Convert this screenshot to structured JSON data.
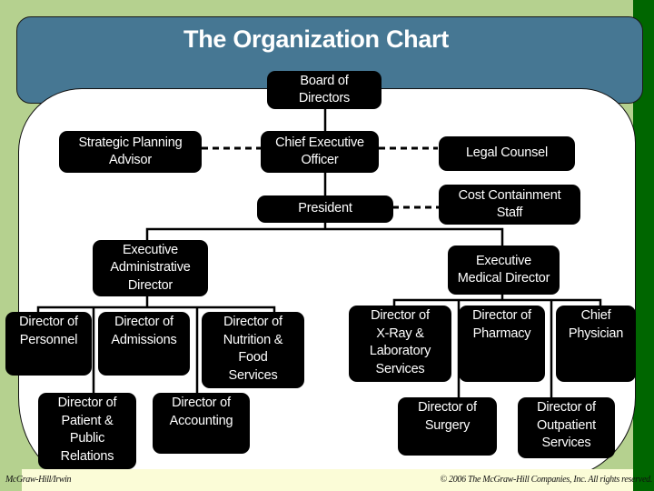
{
  "title": "The Organization Chart",
  "footer": {
    "left": "McGraw-Hill/Irwin",
    "right": "© 2006 The McGraw-Hill Companies, Inc. All rights reserved."
  },
  "colors": {
    "background": "#b5d18f",
    "title_panel": "#467793",
    "accent_bar": "#006600",
    "node_fill": "#000000",
    "node_text": "#ffffff",
    "footer_strip": "#fbfcd7"
  },
  "nodes": {
    "board": "Board of\nDirectors",
    "strategic": "Strategic Planning\nAdvisor",
    "ceo": "Chief Executive\nOfficer",
    "legal": "Legal Counsel",
    "president": "President",
    "cost": "Cost Containment\nStaff",
    "exec_admin": "Executive\nAdministrative\nDirector",
    "exec_med": "Executive\nMedical Director",
    "personnel": "Director of\nPersonnel",
    "admissions": "Director of\nAdmissions",
    "nutrition": "Director of\nNutrition &\nFood\nServices",
    "patient": "Director of\nPatient &\nPublic\nRelations",
    "accounting": "Director of\nAccounting",
    "xray": "Director of\nX-Ray &\nLaboratory\nServices",
    "pharmacy": "Director of\nPharmacy",
    "physician": "Chief\nPhysician",
    "surgery": "Director of\nSurgery",
    "outpatient": "Director of\nOutpatient\nServices"
  },
  "relations": {
    "solid": [
      [
        "board",
        "ceo"
      ],
      [
        "ceo",
        "president"
      ],
      [
        "president",
        "exec_admin"
      ],
      [
        "president",
        "exec_med"
      ],
      [
        "exec_admin",
        "personnel"
      ],
      [
        "exec_admin",
        "admissions"
      ],
      [
        "exec_admin",
        "nutrition"
      ],
      [
        "exec_admin",
        "patient"
      ],
      [
        "exec_admin",
        "accounting"
      ],
      [
        "exec_med",
        "xray"
      ],
      [
        "exec_med",
        "pharmacy"
      ],
      [
        "exec_med",
        "physician"
      ],
      [
        "exec_med",
        "surgery"
      ],
      [
        "exec_med",
        "outpatient"
      ]
    ],
    "dashed": [
      [
        "ceo",
        "strategic"
      ],
      [
        "ceo",
        "legal"
      ],
      [
        "president",
        "cost"
      ]
    ]
  }
}
